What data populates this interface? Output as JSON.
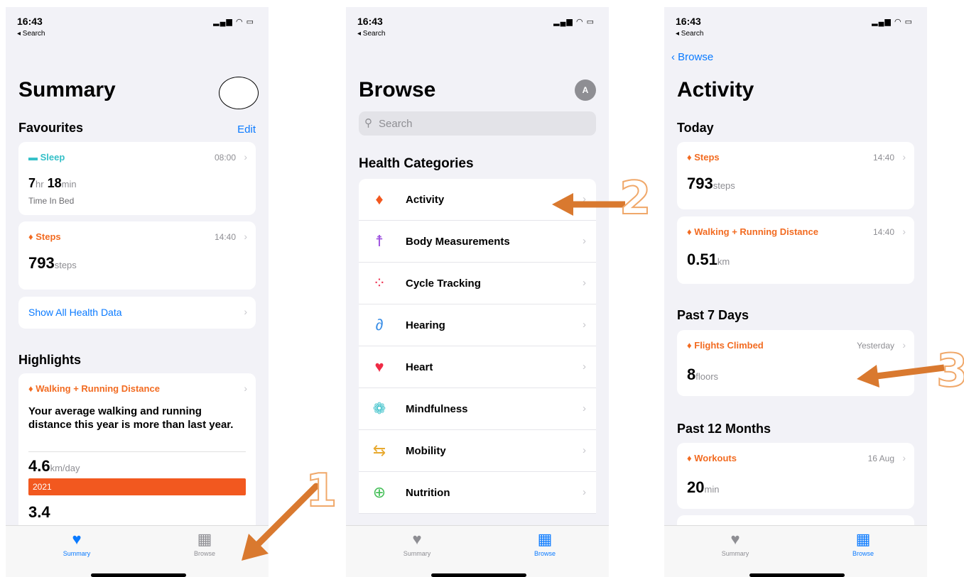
{
  "status": {
    "time": "16:43",
    "back": "◂ Search"
  },
  "summary": {
    "title": "Summary",
    "favourites": "Favourites",
    "edit": "Edit",
    "sleep": {
      "label": "Sleep",
      "time": "08:00",
      "hr": "7",
      "hr_unit": "hr",
      "min": "18",
      "min_unit": "min",
      "sub": "Time In Bed"
    },
    "steps": {
      "label": "Steps",
      "time": "14:40",
      "value": "793",
      "unit": "steps"
    },
    "show_all": "Show All Health Data",
    "highlights": "Highlights",
    "highlight": {
      "label": "Walking + Running Distance",
      "text": "Your average walking and running distance this year is more than last year.",
      "value": "4.6",
      "unit": "km/day",
      "bar_label": "2021",
      "bar_fraction": 1.0,
      "partial": "3.4"
    }
  },
  "browse": {
    "title": "Browse",
    "avatar": "A",
    "search_placeholder": "Search",
    "section": "Health Categories",
    "items": [
      {
        "label": "Activity",
        "icon": "flame-icon"
      },
      {
        "label": "Body Measurements",
        "icon": "figure-icon"
      },
      {
        "label": "Cycle Tracking",
        "icon": "dots-circle-icon"
      },
      {
        "label": "Hearing",
        "icon": "ear-icon"
      },
      {
        "label": "Heart",
        "icon": "heart-icon"
      },
      {
        "label": "Mindfulness",
        "icon": "flower-icon"
      },
      {
        "label": "Mobility",
        "icon": "arrows-icon"
      },
      {
        "label": "Nutrition",
        "icon": "apple-icon"
      }
    ]
  },
  "activity": {
    "back": "Browse",
    "title": "Activity",
    "today": "Today",
    "steps": {
      "label": "Steps",
      "time": "14:40",
      "value": "793",
      "unit": "steps"
    },
    "distance": {
      "label": "Walking + Running Distance",
      "time": "14:40",
      "value": "0.51",
      "unit": "km"
    },
    "past7": "Past 7 Days",
    "flights": {
      "label": "Flights Climbed",
      "time": "Yesterday",
      "value": "8",
      "unit": "floors"
    },
    "past12": "Past 12 Months",
    "workouts": {
      "label": "Workouts",
      "time": "16 Aug",
      "value": "20",
      "unit": "min"
    }
  },
  "tabs": {
    "summary": "Summary",
    "browse": "Browse"
  },
  "annotations": {
    "one": "1",
    "two": "2",
    "three": "3"
  },
  "colors": {
    "accent": "#f26b21",
    "blue": "#0a7aff",
    "teal": "#35c0c8",
    "arrow": "#d9792f"
  }
}
